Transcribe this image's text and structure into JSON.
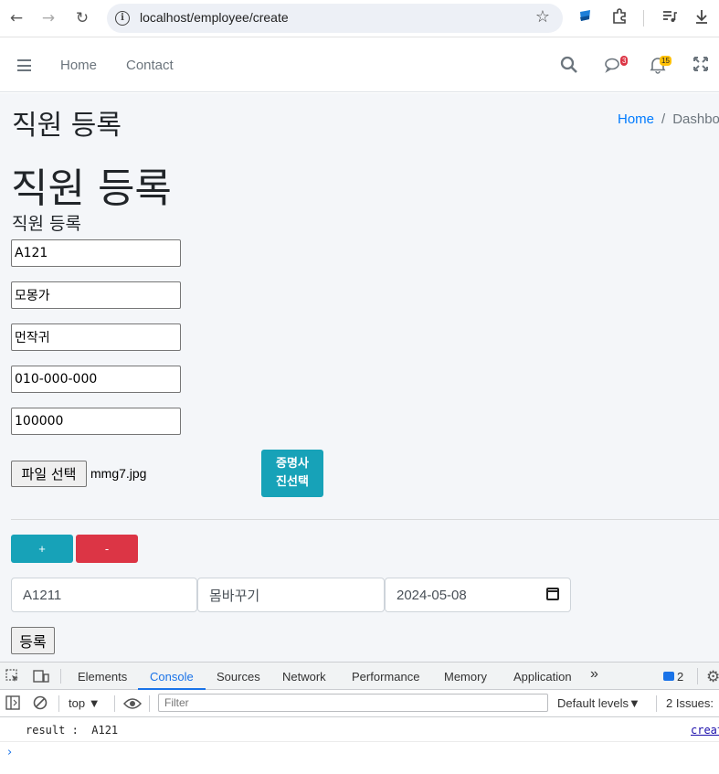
{
  "browser": {
    "url": "localhost/employee/create"
  },
  "navbar": {
    "links": [
      "Home",
      "Contact"
    ],
    "messages_badge": "3",
    "notifications_badge": "15"
  },
  "header": {
    "page_title": "직원 등록",
    "breadcrumb_home": "Home",
    "breadcrumb_sep": "/",
    "breadcrumb_current": "Dashbo"
  },
  "main": {
    "heading1": "직원 등록",
    "heading3": "직원 등록",
    "fields": {
      "emp_id": "A121",
      "name": "모몽가",
      "nickname": "먼작귀",
      "phone": "010-000-000",
      "salary": "100000"
    },
    "file_button": "파일 선택",
    "file_name": "mmg7.jpg",
    "photo_button": "증명사진선택",
    "photo_button_line1": "증명사",
    "photo_button_line2": "진선택",
    "plus_button": "+",
    "minus_button": "-",
    "row": {
      "code": "A1211",
      "item": "몸바꾸기",
      "date": "2024-05-08"
    },
    "submit_button": "등록"
  },
  "devtools": {
    "tabs": [
      "Elements",
      "Console",
      "Sources",
      "Network",
      "Performance",
      "Memory",
      "Application"
    ],
    "active_tab": "Console",
    "message_count": "2",
    "context": "top",
    "filter_placeholder": "Filter",
    "levels": "Default levels",
    "issues": "2 Issues:",
    "log_message": "result :  A121",
    "log_source": "creat"
  },
  "colors": {
    "info": "#17a2b8",
    "danger": "#dc3545",
    "link": "#007bff",
    "content_bg": "#f4f6f9"
  }
}
